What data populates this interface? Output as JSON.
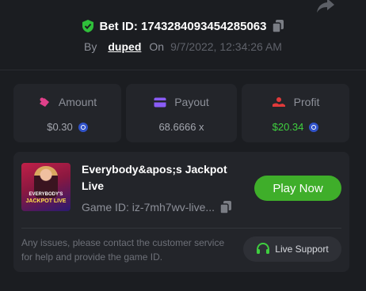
{
  "header": {
    "bet_id_label": "Bet ID: 1743284093454285063",
    "by_label": "By",
    "username": "duped",
    "on_label": "On",
    "date": "9/7/2022, 12:34:26 AM"
  },
  "stats": [
    {
      "label": "Amount",
      "value": "$0.30",
      "icon": "bet-chip-icon",
      "color": "#e0408a"
    },
    {
      "label": "Payout",
      "value": "68.6666 x",
      "icon": "card-icon",
      "color": "#8a5cf6"
    },
    {
      "label": "Profit",
      "value": "$20.34",
      "icon": "hand-coin-icon",
      "color": "#e03a3a"
    }
  ],
  "game": {
    "title": "Everybody&apos;s Jackpot Live",
    "id_label": "Game ID: iz-7mh7wv-live...",
    "thumb_line1": "EVERYBODY'S",
    "thumb_line2": "JACKPOT LIVE",
    "play_label": "Play Now"
  },
  "footer": {
    "issues_text": "Any issues, please contact the customer service for help and provide the game ID.",
    "support_label": "Live Support"
  },
  "colors": {
    "background": "#1b1d21",
    "card": "#23252a",
    "accent_green": "#3fae2a",
    "profit_green": "#3fcf3f",
    "coin_blue": "#3052c8"
  }
}
